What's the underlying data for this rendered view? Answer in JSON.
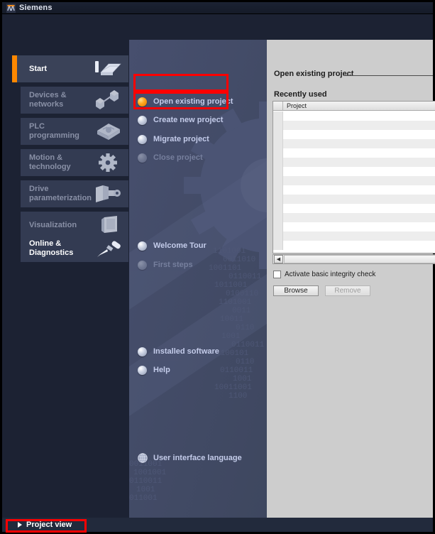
{
  "window": {
    "title": "Siemens",
    "icon": "tia-portal-icon"
  },
  "sidebar": {
    "items": [
      {
        "label": "Start",
        "icon": "start-stack-icon",
        "state": "active"
      },
      {
        "label": "Devices &\nnetworks",
        "icon": "devices-networks-icon",
        "state": "disabled"
      },
      {
        "label": "PLC\nprogramming",
        "icon": "plc-programming-icon",
        "state": "disabled"
      },
      {
        "label": "Motion &\ntechnology",
        "icon": "gear-icon",
        "state": "disabled"
      },
      {
        "label": "Drive\nparameterization",
        "icon": "drive-motor-icon",
        "state": "disabled"
      },
      {
        "label": "Visualization",
        "icon": "hmi-panel-icon",
        "state": "disabled"
      },
      {
        "label": "Online &\nDiagnostics",
        "icon": "screwdriver-icon",
        "state": "enabled"
      }
    ]
  },
  "center": {
    "groups": [
      {
        "items": [
          {
            "label": "Open existing project",
            "bullet": "orange",
            "state": "selected"
          },
          {
            "label": "Create new project",
            "bullet": "grey",
            "state": "normal"
          },
          {
            "label": "Migrate project",
            "bullet": "grey",
            "state": "normal"
          },
          {
            "label": "Close project",
            "bullet": "grey",
            "state": "disabled"
          }
        ]
      },
      {
        "items": [
          {
            "label": "Welcome Tour",
            "bullet": "grey",
            "state": "normal"
          },
          {
            "label": "First steps",
            "bullet": "grey",
            "state": "disabled"
          }
        ]
      },
      {
        "items": [
          {
            "label": "Installed software",
            "bullet": "grey",
            "state": "normal"
          },
          {
            "label": "Help",
            "bullet": "grey",
            "state": "normal"
          }
        ]
      },
      {
        "items": [
          {
            "label": "User interface language",
            "bullet": "globe",
            "state": "normal"
          }
        ]
      }
    ]
  },
  "right": {
    "section_title": "Open existing project",
    "sub_title": "Recently used",
    "table": {
      "columns": [
        "",
        "Project"
      ],
      "rows": []
    },
    "scrollbar": {
      "left_arrow": "◀"
    },
    "checkbox": {
      "label": "Activate basic integrity check",
      "checked": false
    },
    "buttons": [
      {
        "label": "Browse",
        "state": "enabled"
      },
      {
        "label": "Remove",
        "state": "disabled"
      }
    ]
  },
  "bottom": {
    "project_view_label": "Project view",
    "arrow_icon": "triangle-right-icon"
  },
  "colors": {
    "accent_orange": "#ff8800",
    "annotation_red": "#ff0000",
    "sidebar_bg": "#1c2233",
    "center_bg": "#434d6b",
    "right_bg": "#cdcdcd"
  },
  "annotations": [
    {
      "name": "highlight-open-existing-project"
    },
    {
      "name": "highlight-create-new-project"
    },
    {
      "name": "highlight-project-view"
    }
  ]
}
